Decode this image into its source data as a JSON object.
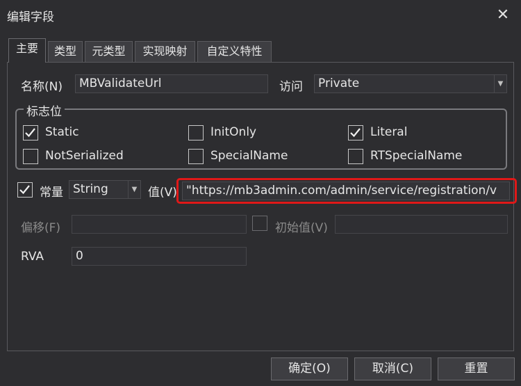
{
  "dialog": {
    "title": "编辑字段"
  },
  "tabs": [
    {
      "label": "主要",
      "active": true
    },
    {
      "label": "类型"
    },
    {
      "label": "元类型"
    },
    {
      "label": "实现映射"
    },
    {
      "label": "自定义特性"
    }
  ],
  "name_row": {
    "label": "名称(N)",
    "value": "MBValidateUrl",
    "access_label": "访问",
    "access_value": "Private"
  },
  "flags": {
    "title": "标志位",
    "items": [
      {
        "label": "Static",
        "checked": true
      },
      {
        "label": "InitOnly",
        "checked": false
      },
      {
        "label": "Literal",
        "checked": true
      },
      {
        "label": "NotSerialized",
        "checked": false
      },
      {
        "label": "SpecialName",
        "checked": false
      },
      {
        "label": "RTSpecialName",
        "checked": false
      }
    ]
  },
  "constant_row": {
    "label": "常量",
    "checked": true,
    "type_value": "String",
    "value_label": "值(V)",
    "value": "\"https://mb3admin.com/admin/service/registration/v"
  },
  "offset_row": {
    "label": "偏移(F)",
    "value": "",
    "initial_label": "初始值(V)",
    "initial_value": ""
  },
  "rva_row": {
    "label": "RVA",
    "value": "0"
  },
  "buttons": {
    "ok": "确定(O)",
    "cancel": "取消(C)",
    "reset": "重置"
  },
  "colors": {
    "background": "#2d2d30",
    "highlight": "#e01818"
  }
}
